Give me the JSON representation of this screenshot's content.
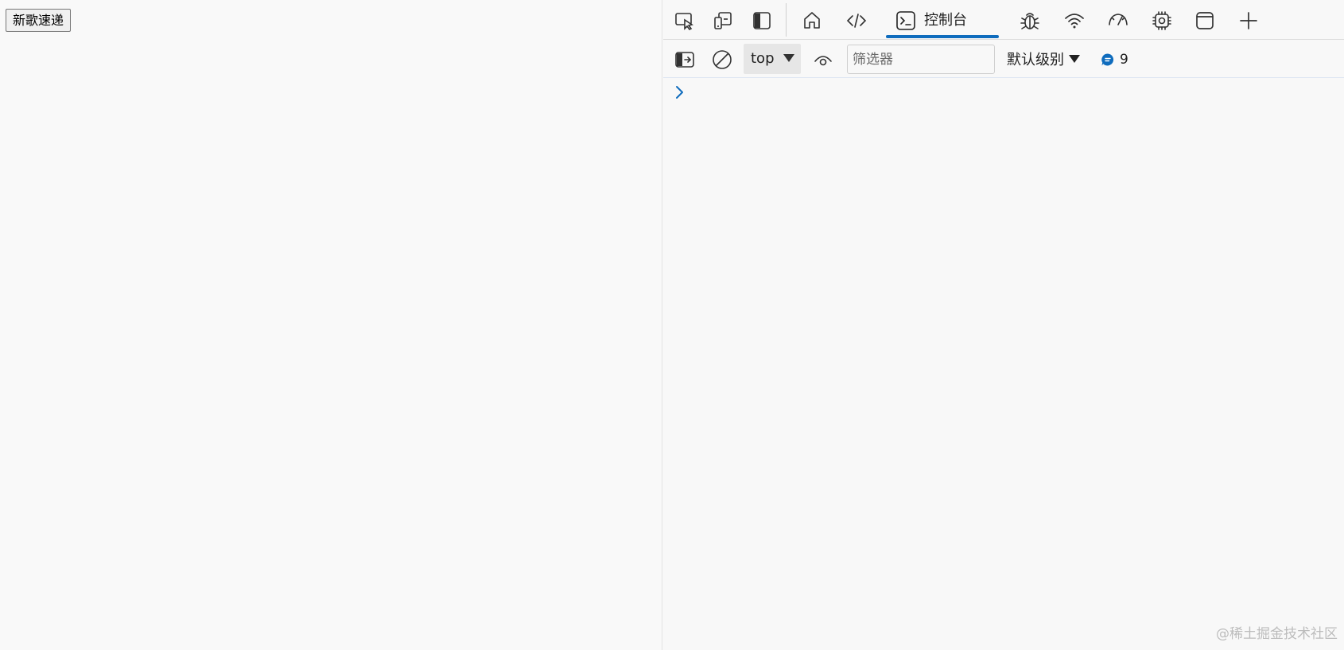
{
  "page": {
    "button_label": "新歌速递"
  },
  "devtools": {
    "tab_strip": {
      "icons": [
        "inspect-element-icon",
        "device-emulation-icon",
        "dock-side-icon",
        "welcome-home-icon",
        "elements-icon",
        "console-icon",
        "sources-debugger-icon",
        "network-icon",
        "performance-icon",
        "memory-icon",
        "application-icon",
        "more-tools-plus-icon"
      ],
      "active_tab_label": "控制台",
      "accent_color": "#0f6cbd"
    },
    "console_toolbar": {
      "context": "top",
      "filter_placeholder": "筛选器",
      "filter_value": "",
      "levels_label": "默认级别",
      "message_count": "9",
      "message_icon_color": "#0f6cbd"
    }
  },
  "watermark": "@稀土掘金技术社区"
}
